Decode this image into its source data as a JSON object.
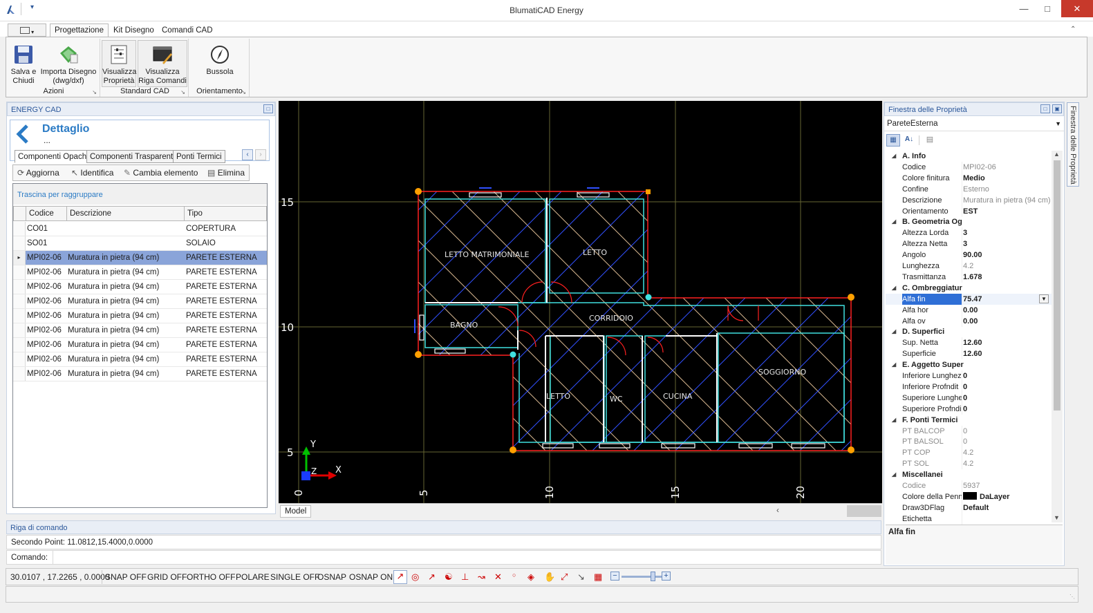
{
  "window": {
    "title": "BlumatiCAD Energy",
    "qat_label": "▾"
  },
  "ribbon": {
    "tabs": [
      "Progettazione",
      "Kit Disegno",
      "Comandi CAD"
    ],
    "groups": [
      {
        "label": "Azioni",
        "buttons": [
          "Salva e\nChiudi",
          "Importa Disegno\n(dwg/dxf)"
        ]
      },
      {
        "label": "Standard CAD",
        "buttons": [
          "Visualizza\nProprietà",
          "Visualizza\nRiga Comandi"
        ]
      },
      {
        "label": "Orientamento",
        "buttons": [
          "Bussola"
        ]
      }
    ]
  },
  "left_panel": {
    "header": "ENERGY CAD",
    "title": "Dettaglio",
    "subtitle": "...",
    "tabs": [
      "Componenti Opachi",
      "Componenti Trasparenti",
      "Ponti Termici"
    ],
    "toolbar": [
      "Aggiorna",
      "Identifica",
      "Cambia elemento",
      "Elimina"
    ],
    "group_hint": "Trascina per raggruppare",
    "columns": [
      "Codice",
      "Descrizione",
      "Tipo"
    ],
    "rows": [
      [
        "CO01",
        "",
        "COPERTURA"
      ],
      [
        "SO01",
        "",
        "SOLAIO"
      ],
      [
        "MPI02-06",
        "Muratura in pietra (94 cm)",
        "PARETE ESTERNA"
      ],
      [
        "MPI02-06",
        "Muratura in pietra (94 cm)",
        "PARETE ESTERNA"
      ],
      [
        "MPI02-06",
        "Muratura in pietra (94 cm)",
        "PARETE ESTERNA"
      ],
      [
        "MPI02-06",
        "Muratura in pietra (94 cm)",
        "PARETE ESTERNA"
      ],
      [
        "MPI02-06",
        "Muratura in pietra (94 cm)",
        "PARETE ESTERNA"
      ],
      [
        "MPI02-06",
        "Muratura in pietra (94 cm)",
        "PARETE ESTERNA"
      ],
      [
        "MPI02-06",
        "Muratura in pietra (94 cm)",
        "PARETE ESTERNA"
      ],
      [
        "MPI02-06",
        "Muratura in pietra (94 cm)",
        "PARETE ESTERNA"
      ],
      [
        "MPI02-06",
        "Muratura in pietra (94 cm)",
        "PARETE ESTERNA"
      ]
    ],
    "selected_row": 2
  },
  "canvas": {
    "y_labels": [
      "15",
      "10",
      "5"
    ],
    "x_labels": [
      "0",
      "5",
      "10",
      "15",
      "20"
    ],
    "rooms": [
      "LETTO MATRIMONIALE",
      "LETTO",
      "BAGNO",
      "CORRIDOIO",
      "LETTO",
      "WC",
      "CUCINA",
      "SOGGIORNO"
    ],
    "axis_x": "X",
    "axis_y": "Y",
    "axis_z": "Z",
    "tab": "Model"
  },
  "properties": {
    "header": "Finestra delle Proprietà",
    "side_tab": "Finestra delle Proprietà",
    "object": "PareteEsterna",
    "rows": [
      {
        "cat": true,
        "k": "A. Info"
      },
      {
        "k": "Codice",
        "v": "MPI02-06",
        "s": "gray"
      },
      {
        "k": "Colore finitura",
        "v": "Medio",
        "s": "bold"
      },
      {
        "k": "Confine",
        "v": "Esterno",
        "s": "gray"
      },
      {
        "k": "Descrizione",
        "v": "Muratura in pietra (94 cm)",
        "s": "gray"
      },
      {
        "k": "Orientamento",
        "v": "EST",
        "s": "bold"
      },
      {
        "cat": true,
        "k": "B. Geometria Og"
      },
      {
        "k": "Altezza Lorda",
        "v": "3",
        "s": "bold"
      },
      {
        "k": "Altezza Netta",
        "v": "3",
        "s": "bold"
      },
      {
        "k": "Angolo",
        "v": "90.00",
        "s": "bold"
      },
      {
        "k": "Lunghezza",
        "v": "4.2",
        "s": "gray"
      },
      {
        "k": "Trasmittanza",
        "v": "1.678",
        "s": "bold"
      },
      {
        "cat": true,
        "k": "C. Ombreggiatur"
      },
      {
        "k": "Alfa fin",
        "v": "75.47",
        "s": "bold",
        "sel": true
      },
      {
        "k": "Alfa hor",
        "v": "0.00",
        "s": "bold"
      },
      {
        "k": "Alfa ov",
        "v": "0.00",
        "s": "bold"
      },
      {
        "cat": true,
        "k": "D. Superfici"
      },
      {
        "k": "Sup. Netta",
        "v": "12.60",
        "s": "bold"
      },
      {
        "k": "Superficie",
        "v": "12.60",
        "s": "bold"
      },
      {
        "cat": true,
        "k": "E. Aggetto Super"
      },
      {
        "k": "Inferiore Lunghez",
        "v": "0",
        "s": "bold"
      },
      {
        "k": "Inferiore Profndit",
        "v": "0",
        "s": "bold"
      },
      {
        "k": "Superiore Lunghe",
        "v": "0",
        "s": "bold"
      },
      {
        "k": "Superiore Profndi",
        "v": "0",
        "s": "bold"
      },
      {
        "cat": true,
        "k": "F. Ponti Termici"
      },
      {
        "k": "PT BALCOP",
        "v": "0",
        "s": "gray",
        "kgray": true
      },
      {
        "k": "PT BALSOL",
        "v": "0",
        "s": "gray",
        "kgray": true
      },
      {
        "k": "PT COP",
        "v": "4.2",
        "s": "gray",
        "kgray": true
      },
      {
        "k": "PT SOL",
        "v": "4.2",
        "s": "gray",
        "kgray": true
      },
      {
        "cat": true,
        "k": "Miscellanei"
      },
      {
        "k": "Codice",
        "v": "5937",
        "s": "gray",
        "kgray": true
      },
      {
        "k": "Colore della Penna",
        "v": "DaLayer",
        "s": "bold",
        "swatch": "#000000"
      },
      {
        "k": "Draw3DFlag",
        "v": "Default",
        "s": "bold"
      },
      {
        "k": "Etichetta",
        "v": "",
        "s": ""
      }
    ],
    "description_title": "Alfa fin"
  },
  "command": {
    "header": "Riga di comando",
    "history": "Secondo Point: 11.0812,15.4000,0.0000",
    "prompt": "Comando:"
  },
  "status": {
    "coords": "30.0107 , 17.2265 , 0.0000",
    "toggles": [
      "SNAP OFF",
      "GRID OFF",
      "ORTHO OFF",
      "POLARE",
      "SINGLE OFF",
      "OSNAP",
      "OSNAP ON"
    ]
  },
  "colors": {
    "accent": "#2b7bc5",
    "selection": "#8aa4d9",
    "close": "#c7392b",
    "wall": "#ff2020",
    "hatch_cyan": "#40e0e0",
    "hatch_blue": "#3050ff",
    "hatch_tan": "#d8b890"
  }
}
